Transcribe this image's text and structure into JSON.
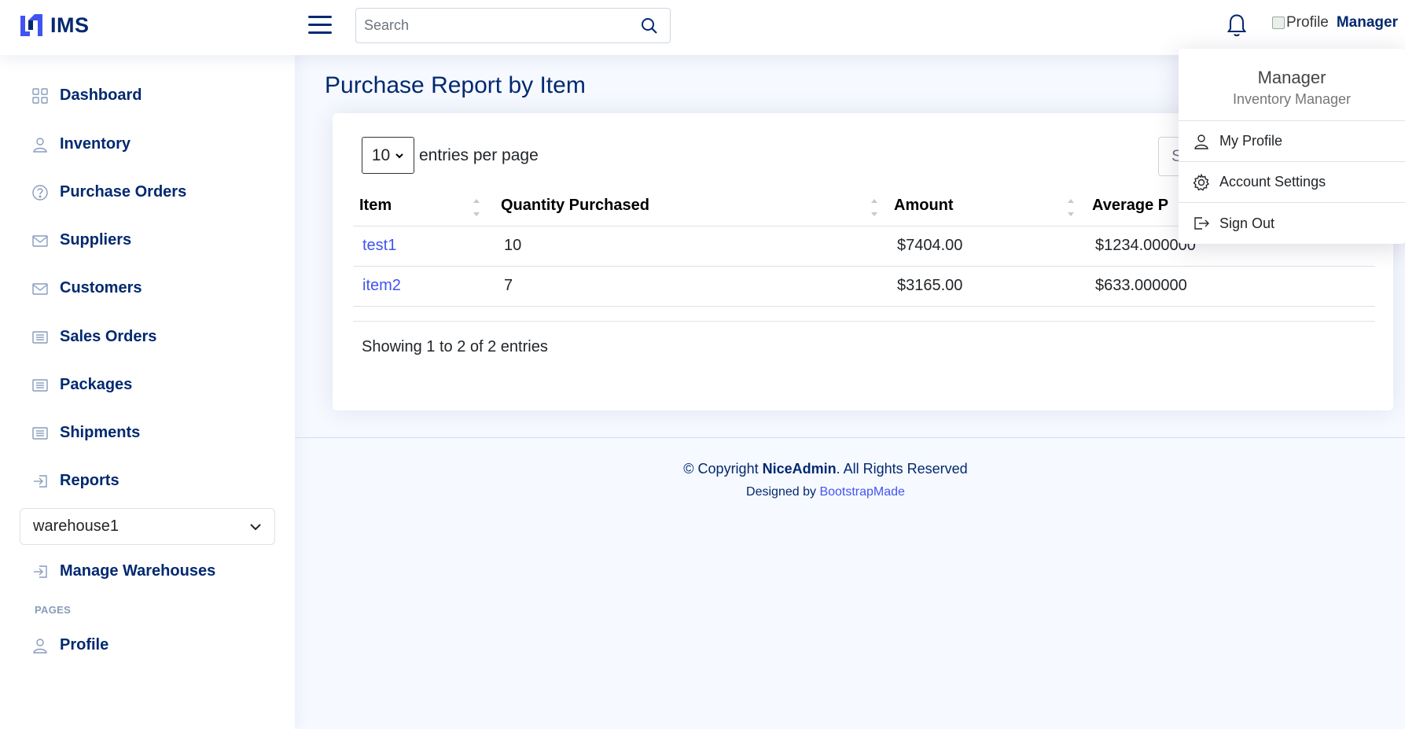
{
  "header": {
    "logo_text": "IMS",
    "search_placeholder": "Search",
    "profile_img_alt": "Profile",
    "profile_name": "Manager"
  },
  "sidebar": {
    "items": [
      {
        "label": "Dashboard",
        "icon": "grid-icon"
      },
      {
        "label": "Inventory",
        "icon": "person-icon"
      },
      {
        "label": "Purchase Orders",
        "icon": "question-circle-icon"
      },
      {
        "label": "Suppliers",
        "icon": "envelope-icon"
      },
      {
        "label": "Customers",
        "icon": "envelope-icon"
      },
      {
        "label": "Sales Orders",
        "icon": "list-icon"
      },
      {
        "label": "Packages",
        "icon": "list-icon"
      },
      {
        "label": "Shipments",
        "icon": "list-icon"
      },
      {
        "label": "Reports",
        "icon": "box-arrow-in-icon"
      }
    ],
    "warehouse": "warehouse1",
    "manage_warehouses": "Manage Warehouses",
    "pages_heading": "PAGES",
    "profile": "Profile"
  },
  "main": {
    "title": "Purchase Report by Item",
    "per_page_value": "10",
    "per_page_label": "entries per page",
    "search_stub": "S",
    "table": {
      "headers": [
        "Item",
        "Quantity Purchased",
        "Amount",
        "Average P"
      ],
      "rows": [
        [
          "test1",
          "10",
          "$7404.00",
          "$1234.000000"
        ],
        [
          "item2",
          "7",
          "$3165.00",
          "$633.000000"
        ]
      ]
    },
    "showing": "Showing 1 to 2 of 2 entries"
  },
  "footer": {
    "copyright_prefix": "© Copyright ",
    "brand": "NiceAdmin",
    "copyright_suffix": ". All Rights Reserved",
    "designed_by": "Designed by ",
    "designer": "BootstrapMade"
  },
  "dropdown": {
    "name": "Manager",
    "role": "Inventory Manager",
    "items": [
      "My Profile",
      "Account Settings",
      "Sign Out"
    ]
  },
  "colors": {
    "brand": "#012970",
    "accent": "#4154f1",
    "background": "#f6f9ff"
  }
}
